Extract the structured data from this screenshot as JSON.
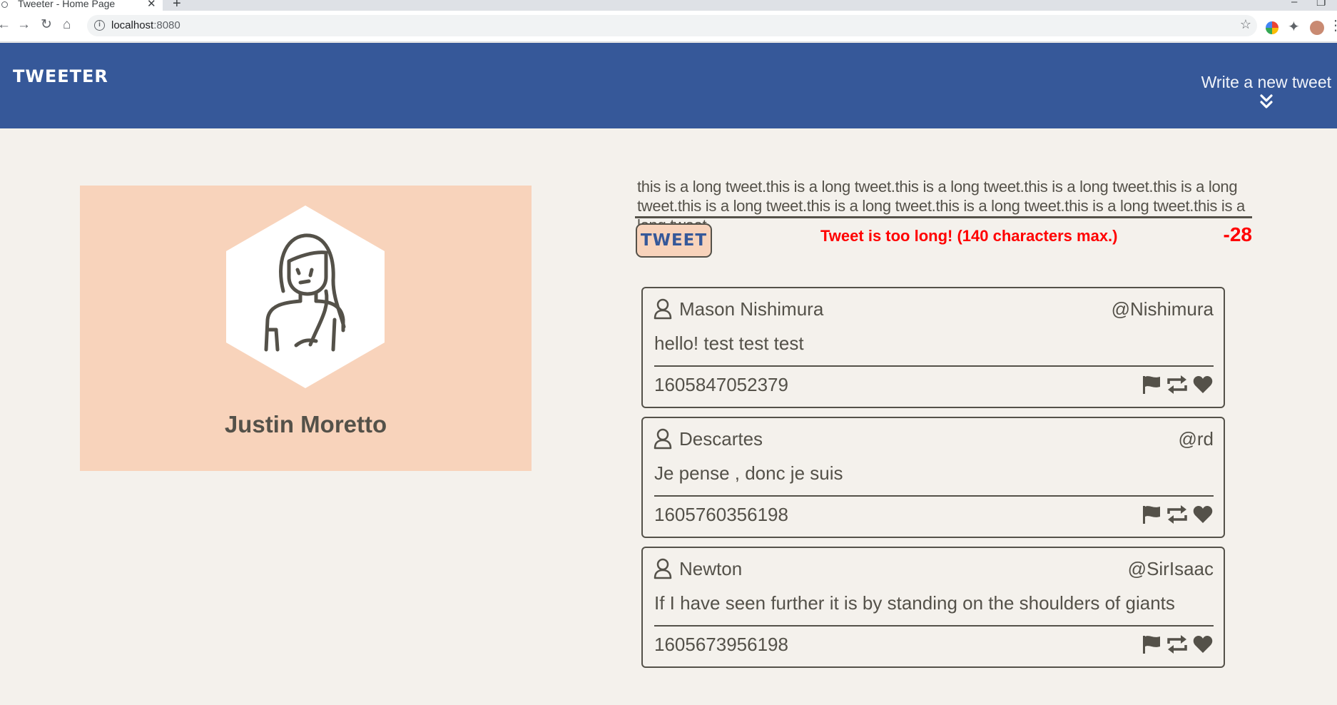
{
  "browser": {
    "tab_title": "Tweeter - Home Page",
    "url_host": "localhost",
    "url_port": ":8080"
  },
  "header": {
    "brand": "TWEETER",
    "write_new": "Write a new tweet",
    "icon": "double-chevron-down-icon"
  },
  "profile": {
    "name": "Justin Moretto",
    "avatar_icon": "woman-avatar-icon",
    "card_color": "#f8d3bb"
  },
  "compose": {
    "text": "this is a long tweet.this is a long tweet.this is a long tweet.this is a long tweet.this is a long tweet.this is a long tweet.this is a long tweet.this is a long tweet.this is a long tweet.this is a long tweet.",
    "button_label": "TWEET",
    "error": "Tweet is too long! (140 characters max.)",
    "counter": "-28",
    "error_color": "#ff0000"
  },
  "tweets": [
    {
      "name": "Mason Nishimura",
      "handle": "@Nishimura",
      "text": "hello! test test test",
      "timestamp": "1605847052379"
    },
    {
      "name": "Descartes",
      "handle": "@rd",
      "text": "Je pense , donc je suis",
      "timestamp": "1605760356198"
    },
    {
      "name": "Newton",
      "handle": "@SirIsaac",
      "text": "If I have seen further it is by standing on the shoulders of giants",
      "timestamp": "1605673956198"
    }
  ],
  "colors": {
    "header_bg": "#365899",
    "page_bg": "#f4f1ec",
    "text": "#545149"
  }
}
